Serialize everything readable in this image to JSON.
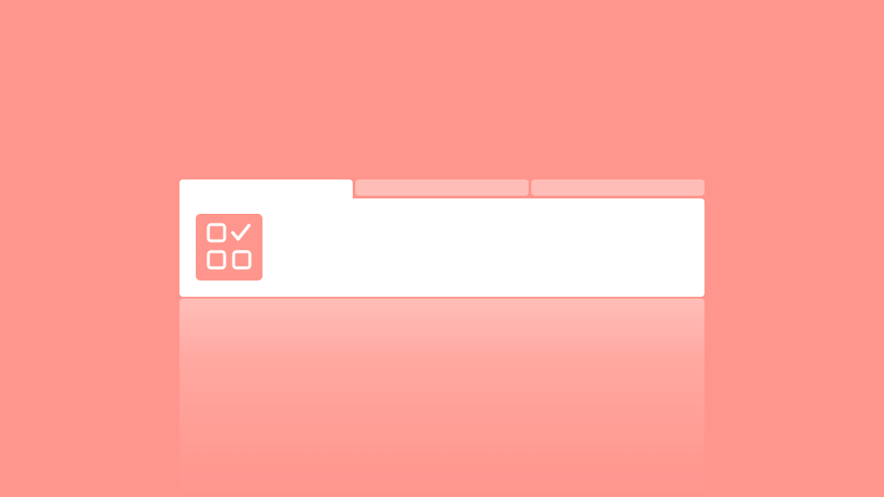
{
  "theme": {
    "background": "#ff968d",
    "panel": "#ffffff",
    "inactive_tab": "#ffbdb7",
    "icon_bg": "#ff968d",
    "icon_fg": "#ffffff"
  },
  "tabs": [
    {
      "label": "",
      "active": true
    },
    {
      "label": "",
      "active": false
    },
    {
      "label": "",
      "active": false
    }
  ],
  "panel": {
    "icon": "checklist-grid-icon"
  }
}
